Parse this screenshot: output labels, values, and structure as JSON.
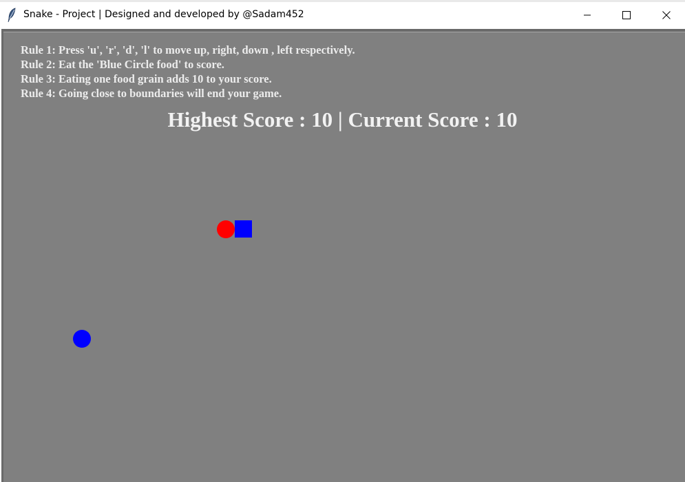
{
  "window": {
    "title": "Snake - Project | Designed and developed by @Sadam452",
    "icon": "feather-icon",
    "controls": {
      "minimize_icon": "minimize-icon",
      "maximize_icon": "maximize-icon",
      "close_icon": "close-icon"
    }
  },
  "rules": [
    "Rule 1: Press 'u', 'r', 'd', 'l' to move up, right, down , left respectively.",
    "Rule 2: Eat the 'Blue Circle food' to score.",
    "Rule 3: Eating one food grain adds 10 to your score.",
    "Rule 4: Going close to boundaries will end your game."
  ],
  "score_text": "Highest Score : 10 | Current Score : 10",
  "colors": {
    "canvas_background": "#808080",
    "snake_head": "#ff0000",
    "snake_body": "#0000ff",
    "food": "#0000ff",
    "text": "#f2f2f2"
  }
}
